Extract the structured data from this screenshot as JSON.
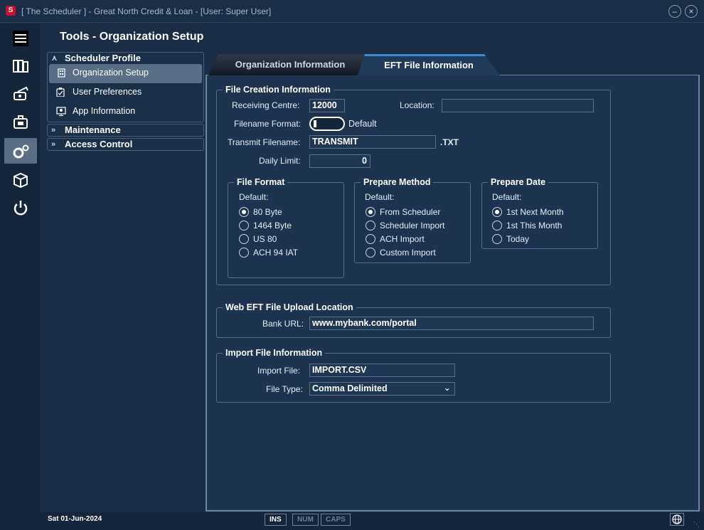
{
  "window": {
    "title": "[ The Scheduler ] - Great North Credit & Loan - [User: Super User]",
    "logo_letter": "S"
  },
  "page": {
    "title": "Tools - Organization Setup"
  },
  "sidebar": {
    "items": [
      "menu-icon",
      "ledger-icon",
      "payment-icon",
      "briefcase-icon",
      "gear-icon",
      "package-icon",
      "power-icon"
    ]
  },
  "nav": {
    "scheduler_profile": {
      "label": "Scheduler Profile",
      "items": [
        "Organization Setup",
        "User Preferences",
        "App Information"
      ]
    },
    "maintenance": {
      "label": "Maintenance"
    },
    "access_control": {
      "label": "Access Control"
    }
  },
  "tabs": {
    "org_info": "Organization Information",
    "eft_info": "EFT File Information"
  },
  "file_creation": {
    "legend": "File Creation Information",
    "receiving_centre_label": "Receiving Centre:",
    "receiving_centre_value": "12000",
    "location_label": "Location:",
    "location_value": "",
    "filename_format_label": "Filename Format:",
    "filename_format_toggle_label": "Default",
    "transmit_filename_label": "Transmit Filename:",
    "transmit_filename_value": "TRANSMIT",
    "transmit_ext": ".TXT",
    "daily_limit_label": "Daily Limit:",
    "daily_limit_value": "0"
  },
  "file_format": {
    "legend": "File Format",
    "default_label": "Default:",
    "options": [
      "80 Byte",
      "1464 Byte",
      "US 80",
      "ACH 94 IAT"
    ],
    "selected": "80 Byte"
  },
  "prepare_method": {
    "legend": "Prepare Method",
    "default_label": "Default:",
    "options": [
      "From Scheduler",
      "Scheduler Import",
      "ACH Import",
      "Custom Import"
    ],
    "selected": "From Scheduler"
  },
  "prepare_date": {
    "legend": "Prepare Date",
    "default_label": "Default:",
    "options": [
      "1st Next Month",
      "1st This Month",
      "Today"
    ],
    "selected": "1st Next Month"
  },
  "web_eft": {
    "legend": "Web EFT File Upload Location",
    "bank_url_label": "Bank URL:",
    "bank_url_value": "www.mybank.com/portal"
  },
  "import_file": {
    "legend": "Import File Information",
    "import_file_label": "Import File:",
    "import_file_value": "IMPORT.CSV",
    "file_type_label": "File Type:",
    "file_type_value": "Comma Delimited"
  },
  "status": {
    "date": "Sat  01-Jun-2024",
    "keys": [
      "INS",
      "NUM",
      "CAPS"
    ]
  }
}
